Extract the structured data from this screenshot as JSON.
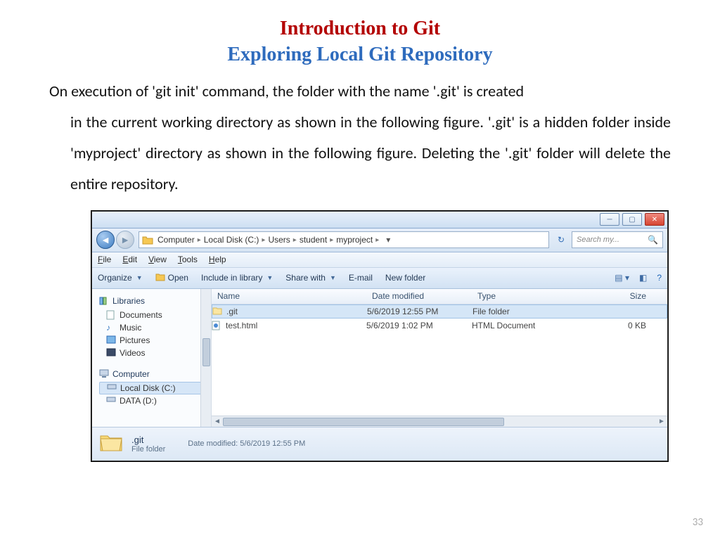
{
  "page": {
    "number": "33"
  },
  "heading": {
    "title": "Introduction to Git",
    "subtitle": "Exploring Local Git Repository"
  },
  "paragraph": {
    "line1": "On execution of 'git init' command, the folder with the name '.git' is created",
    "rest": "in the current working directory as shown in the following figure. '.git' is a hidden folder inside 'myproject' directory as shown in the following figure. Deleting the '.git' folder will delete the entire repository."
  },
  "explorer": {
    "breadcrumb": [
      "Computer",
      "Local Disk (C:)",
      "Users",
      "student",
      "myproject"
    ],
    "search_placeholder": "Search my...",
    "menu": {
      "file": "File",
      "edit": "Edit",
      "view": "View",
      "tools": "Tools",
      "help": "Help"
    },
    "toolbar": {
      "organize": "Organize",
      "open": "Open",
      "include": "Include in library",
      "share": "Share with",
      "email": "E-mail",
      "newfolder": "New folder"
    },
    "sidebar": {
      "libraries": "Libraries",
      "documents": "Documents",
      "music": "Music",
      "pictures": "Pictures",
      "videos": "Videos",
      "computer": "Computer",
      "localdisk": "Local Disk (C:)",
      "data": "DATA (D:)"
    },
    "columns": {
      "name": "Name",
      "date": "Date modified",
      "type": "Type",
      "size": "Size"
    },
    "rows": [
      {
        "name": ".git",
        "date": "5/6/2019 12:55 PM",
        "type": "File folder",
        "size": ""
      },
      {
        "name": "test.html",
        "date": "5/6/2019 1:02 PM",
        "type": "HTML Document",
        "size": "0 KB"
      }
    ],
    "details": {
      "name": ".git",
      "type": "File folder",
      "modified_label": "Date modified:",
      "modified": "5/6/2019 12:55 PM"
    }
  }
}
